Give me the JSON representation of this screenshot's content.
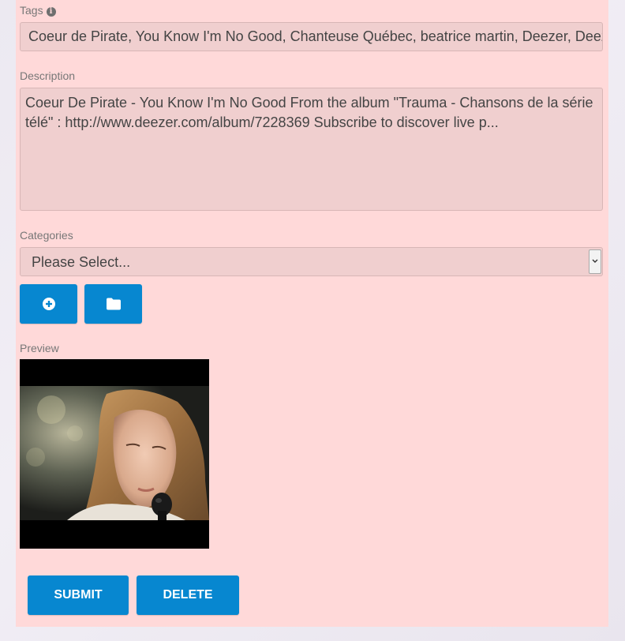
{
  "tags": {
    "label": "Tags",
    "value": "Coeur de Pirate, You Know I'm No Good, Chanteuse Québec, beatrice martin, Deezer, Deezer Sessions"
  },
  "description": {
    "label": "Description",
    "value": "Coeur De Pirate - You Know I'm No Good From the album \"Trauma - Chansons de la série télé\" : http://www.deezer.com/album/7228369 Subscribe to discover live p..."
  },
  "categories": {
    "label": "Categories",
    "selected": "Please Select..."
  },
  "toolbar": {
    "add_icon": "plus-circle-icon",
    "folder_icon": "folder-icon"
  },
  "preview": {
    "label": "Preview"
  },
  "actions": {
    "submit_label": "SUBMIT",
    "delete_label": "DELETE"
  },
  "colors": {
    "panel_background": "#ffd9d9",
    "field_background": "#f0cfcf",
    "button_blue": "#0787d0"
  }
}
